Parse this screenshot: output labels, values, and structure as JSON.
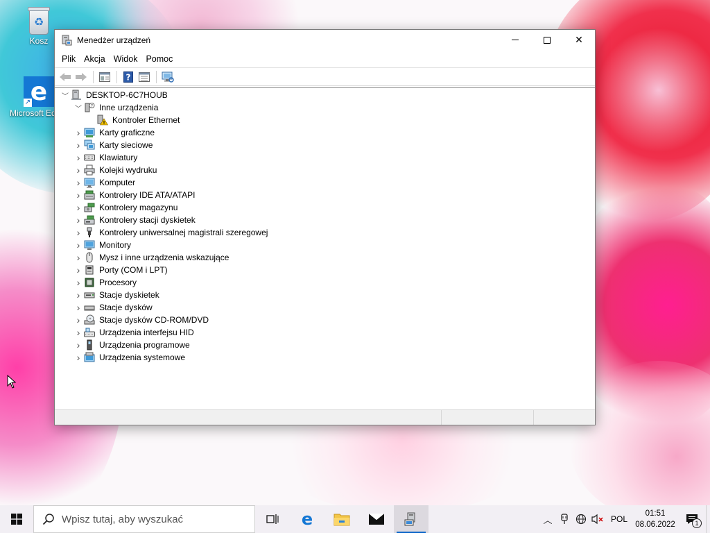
{
  "desktop": {
    "icons": [
      {
        "label": "Kosz",
        "icon": "recycle-bin-icon"
      },
      {
        "label": "Microsoft Edge",
        "icon": "edge-icon"
      }
    ]
  },
  "window": {
    "title": "Menedżer urządzeń",
    "controls": {
      "minimize": "minimize",
      "maximize": "maximize",
      "close": "✕"
    },
    "menu": [
      "Plik",
      "Akcja",
      "Widok",
      "Pomoc"
    ],
    "toolbar": [
      "back-icon",
      "forward-icon",
      "properties-icon",
      "help-icon",
      "view-icon",
      "scan-hardware-icon"
    ],
    "tree": {
      "root": {
        "label": "DESKTOP-6C7HOUB",
        "expanded": true
      },
      "categories": [
        {
          "label": "Inne urządzenia",
          "expanded": true,
          "icon": "unknown-device-icon",
          "children": [
            {
              "label": "Kontroler Ethernet",
              "icon": "warning-device-icon"
            }
          ]
        },
        {
          "label": "Karty graficzne",
          "icon": "display-adapter-icon"
        },
        {
          "label": "Karty sieciowe",
          "icon": "network-adapter-icon"
        },
        {
          "label": "Klawiatury",
          "icon": "keyboard-icon"
        },
        {
          "label": "Kolejki wydruku",
          "icon": "printer-icon"
        },
        {
          "label": "Komputer",
          "icon": "computer-icon"
        },
        {
          "label": "Kontrolery IDE ATA/ATAPI",
          "icon": "ide-controller-icon"
        },
        {
          "label": "Kontrolery magazynu",
          "icon": "storage-controller-icon"
        },
        {
          "label": "Kontrolery stacji dyskietek",
          "icon": "floppy-controller-icon"
        },
        {
          "label": "Kontrolery uniwersalnej magistrali szeregowej",
          "icon": "usb-icon"
        },
        {
          "label": "Monitory",
          "icon": "monitor-icon"
        },
        {
          "label": "Mysz i inne urządzenia wskazujące",
          "icon": "mouse-icon"
        },
        {
          "label": "Porty (COM i LPT)",
          "icon": "port-icon"
        },
        {
          "label": "Procesory",
          "icon": "processor-icon"
        },
        {
          "label": "Stacje dyskietek",
          "icon": "floppy-drive-icon"
        },
        {
          "label": "Stacje dysków",
          "icon": "disk-drive-icon"
        },
        {
          "label": "Stacje dysków CD-ROM/DVD",
          "icon": "cdrom-icon"
        },
        {
          "label": "Urządzenia interfejsu HID",
          "icon": "hid-icon"
        },
        {
          "label": "Urządzenia programowe",
          "icon": "software-device-icon"
        },
        {
          "label": "Urządzenia systemowe",
          "icon": "system-device-icon"
        }
      ]
    }
  },
  "taskbar": {
    "search_placeholder": "Wpisz tutaj, aby wyszukać",
    "apps": [
      "task-view-icon",
      "edge-icon",
      "file-explorer-icon",
      "mail-icon",
      "device-manager-icon"
    ],
    "tray": {
      "language": "POL",
      "time": "01:51",
      "date": "08.06.2022",
      "notification_count": "1"
    }
  },
  "colors": {
    "accent": "#0a64c8",
    "taskbar_bg": "#f2eff4",
    "warning": "#f0c000"
  }
}
